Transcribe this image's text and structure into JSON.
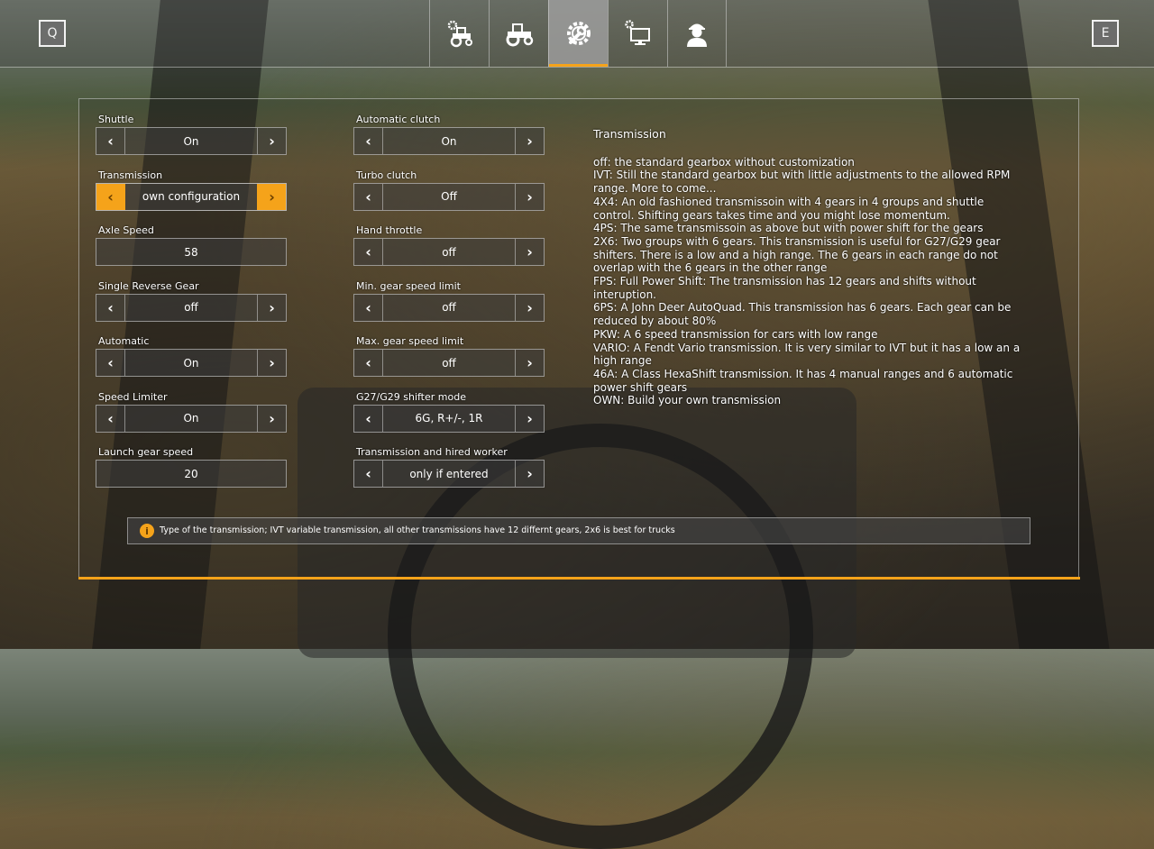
{
  "keys": {
    "prev": "Q",
    "next": "E"
  },
  "tabs": [
    {
      "icon": "tractor-settings-icon",
      "active": false
    },
    {
      "icon": "tractor-icon",
      "active": false
    },
    {
      "icon": "wrench-gear-icon",
      "active": true
    },
    {
      "icon": "display-settings-icon",
      "active": false
    },
    {
      "icon": "worker-icon",
      "active": false
    }
  ],
  "settings_left": [
    {
      "label": "Shuttle",
      "value": "On",
      "arrows": true
    },
    {
      "label": "Transmission",
      "value": "own configuration",
      "arrows": true,
      "active": true
    },
    {
      "label": "Axle Speed",
      "value": "58",
      "arrows": false
    },
    {
      "label": "Single Reverse Gear",
      "value": "off",
      "arrows": true
    },
    {
      "label": "Automatic",
      "value": "On",
      "arrows": true
    },
    {
      "label": "Speed Limiter",
      "value": "On",
      "arrows": true
    },
    {
      "label": "Launch gear speed",
      "value": "20",
      "arrows": false
    }
  ],
  "settings_right": [
    {
      "label": "Automatic clutch",
      "value": "On",
      "arrows": true
    },
    {
      "label": "Turbo clutch",
      "value": "Off",
      "arrows": true
    },
    {
      "label": "Hand throttle",
      "value": "off",
      "arrows": true
    },
    {
      "label": "Min. gear speed limit",
      "value": "off",
      "arrows": true
    },
    {
      "label": "Max. gear speed limit",
      "value": "off",
      "arrows": true
    },
    {
      "label": "G27/G29 shifter mode",
      "value": "6G, R+/-, 1R",
      "arrows": true
    },
    {
      "label": "Transmission and hired worker",
      "value": "only if entered",
      "arrows": true
    }
  ],
  "arrow_left": "‹",
  "arrow_right": "›",
  "help": {
    "title": "Transmission",
    "lines": [
      "off: the standard gearbox without customization",
      "IVT: Still the standard gearbox but with little adjustments to the allowed RPM range. More to come...",
      "4X4: An old fashioned transmissoin with 4 gears in 4 groups and shuttle control. Shifting gears takes time and you might lose momentum.",
      "4PS: The same transmissoin as above but with power shift for the gears",
      "2X6: Two groups with 6 gears. This transmission is useful for G27/G29 gear shifters. There is a low and a high range. The 6 gears in each range do not overlap with the 6 gears in the other range",
      "FPS: Full Power Shift: The transmission has 12 gears and shifts without interuption.",
      "6PS: A John Deer AutoQuad. This transmission has 6 gears. Each gear can be reduced by about 80%",
      "PKW: A 6 speed transmission for cars with low range",
      "VARIO: A Fendt Vario transmission. It is very similar to IVT but it has a low an a high range",
      "46A: A Class HexaShift transmission. It has 4 manual ranges and 6 automatic power shift gears",
      "OWN: Build your own transmission"
    ]
  },
  "tooltip": {
    "icon": "info-icon",
    "text": "Type of the transmission; IVT variable transmission, all other transmissions have 12 differnt gears, 2x6 is best for trucks"
  },
  "colors": {
    "accent": "#f5a31a"
  }
}
